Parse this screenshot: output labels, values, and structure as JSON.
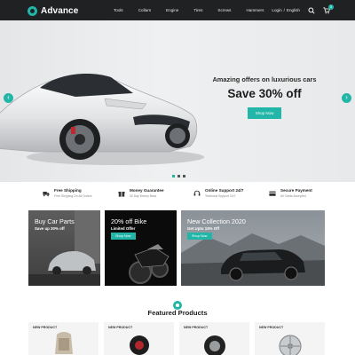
{
  "brand": {
    "name": "Advance",
    "accent": "#21b6a8"
  },
  "nav": {
    "items": [
      "Tools",
      "Collars",
      "Engine",
      "Tires",
      "Screws",
      "Hammers"
    ]
  },
  "header_right": {
    "login": "Login",
    "separator": "/",
    "language": "English",
    "cart_count": "0"
  },
  "hero": {
    "subtitle": "Amazing offers on luxurious cars",
    "title": "Save 30% off",
    "button": "Shop Now",
    "prev_arrow": "‹",
    "next_arrow": "›"
  },
  "features": [
    {
      "title": "Free Shipping",
      "sub": "Free Shipping On All Orders",
      "icon": "truck-icon"
    },
    {
      "title": "Money Guarantee",
      "sub": "30 Day Money Back",
      "icon": "gift-icon"
    },
    {
      "title": "Online Support 24/7",
      "sub": "Technical Support 24/7",
      "icon": "support-icon"
    },
    {
      "title": "Secure Payment",
      "sub": "All Cards Accepted",
      "icon": "payment-icon"
    }
  ],
  "banners": [
    {
      "title": "Buy Car Parts",
      "sub": "Save up 30% off"
    },
    {
      "title": "20% off Bike",
      "sub": "Limited Offer",
      "button": "Shop Now"
    },
    {
      "title": "New Collection 2020",
      "sub": "Get Upto 15% Off",
      "button": "Shop Now"
    }
  ],
  "featured": {
    "title": "Featured Products"
  },
  "products": [
    {
      "tag": "NEW PRODUCT"
    },
    {
      "tag": "NEW PRODUCT"
    },
    {
      "tag": "NEW PRODUCT"
    },
    {
      "tag": "NEW PRODUCT"
    }
  ]
}
